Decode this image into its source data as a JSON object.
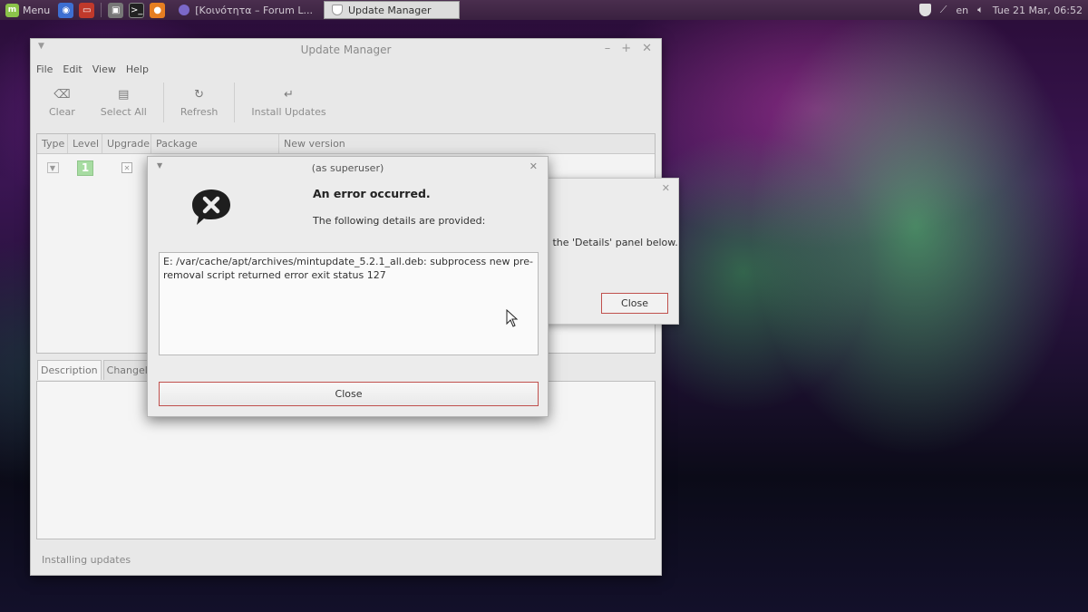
{
  "panel": {
    "menu_label": "Menu",
    "task_forum": "[Κοινότητα – Forum L...",
    "task_active": "Update Manager",
    "lang": "en",
    "clock": "Tue 21 Mar, 06:52"
  },
  "window": {
    "title": "Update Manager",
    "menu": [
      "File",
      "Edit",
      "View",
      "Help"
    ],
    "toolbar": {
      "clear": "Clear",
      "select_all": "Select All",
      "refresh": "Refresh",
      "install": "Install Updates"
    },
    "columns": [
      "Type",
      "Level",
      "Upgrade",
      "Package",
      "New version"
    ],
    "row": {
      "level": "1"
    },
    "tabs": {
      "description": "Description",
      "changelog": "Changelog"
    },
    "status": "Installing updates"
  },
  "bg_dialog": {
    "text": "d the 'Details' panel below.",
    "close": "Close"
  },
  "error_dialog": {
    "title": "(as superuser)",
    "heading": "An error occurred.",
    "subheading": "The following details are provided:",
    "details": "E: /var/cache/apt/archives/mintupdate_5.2.1_all.deb: subprocess new pre-removal script returned error exit status 127",
    "close": "Close"
  }
}
